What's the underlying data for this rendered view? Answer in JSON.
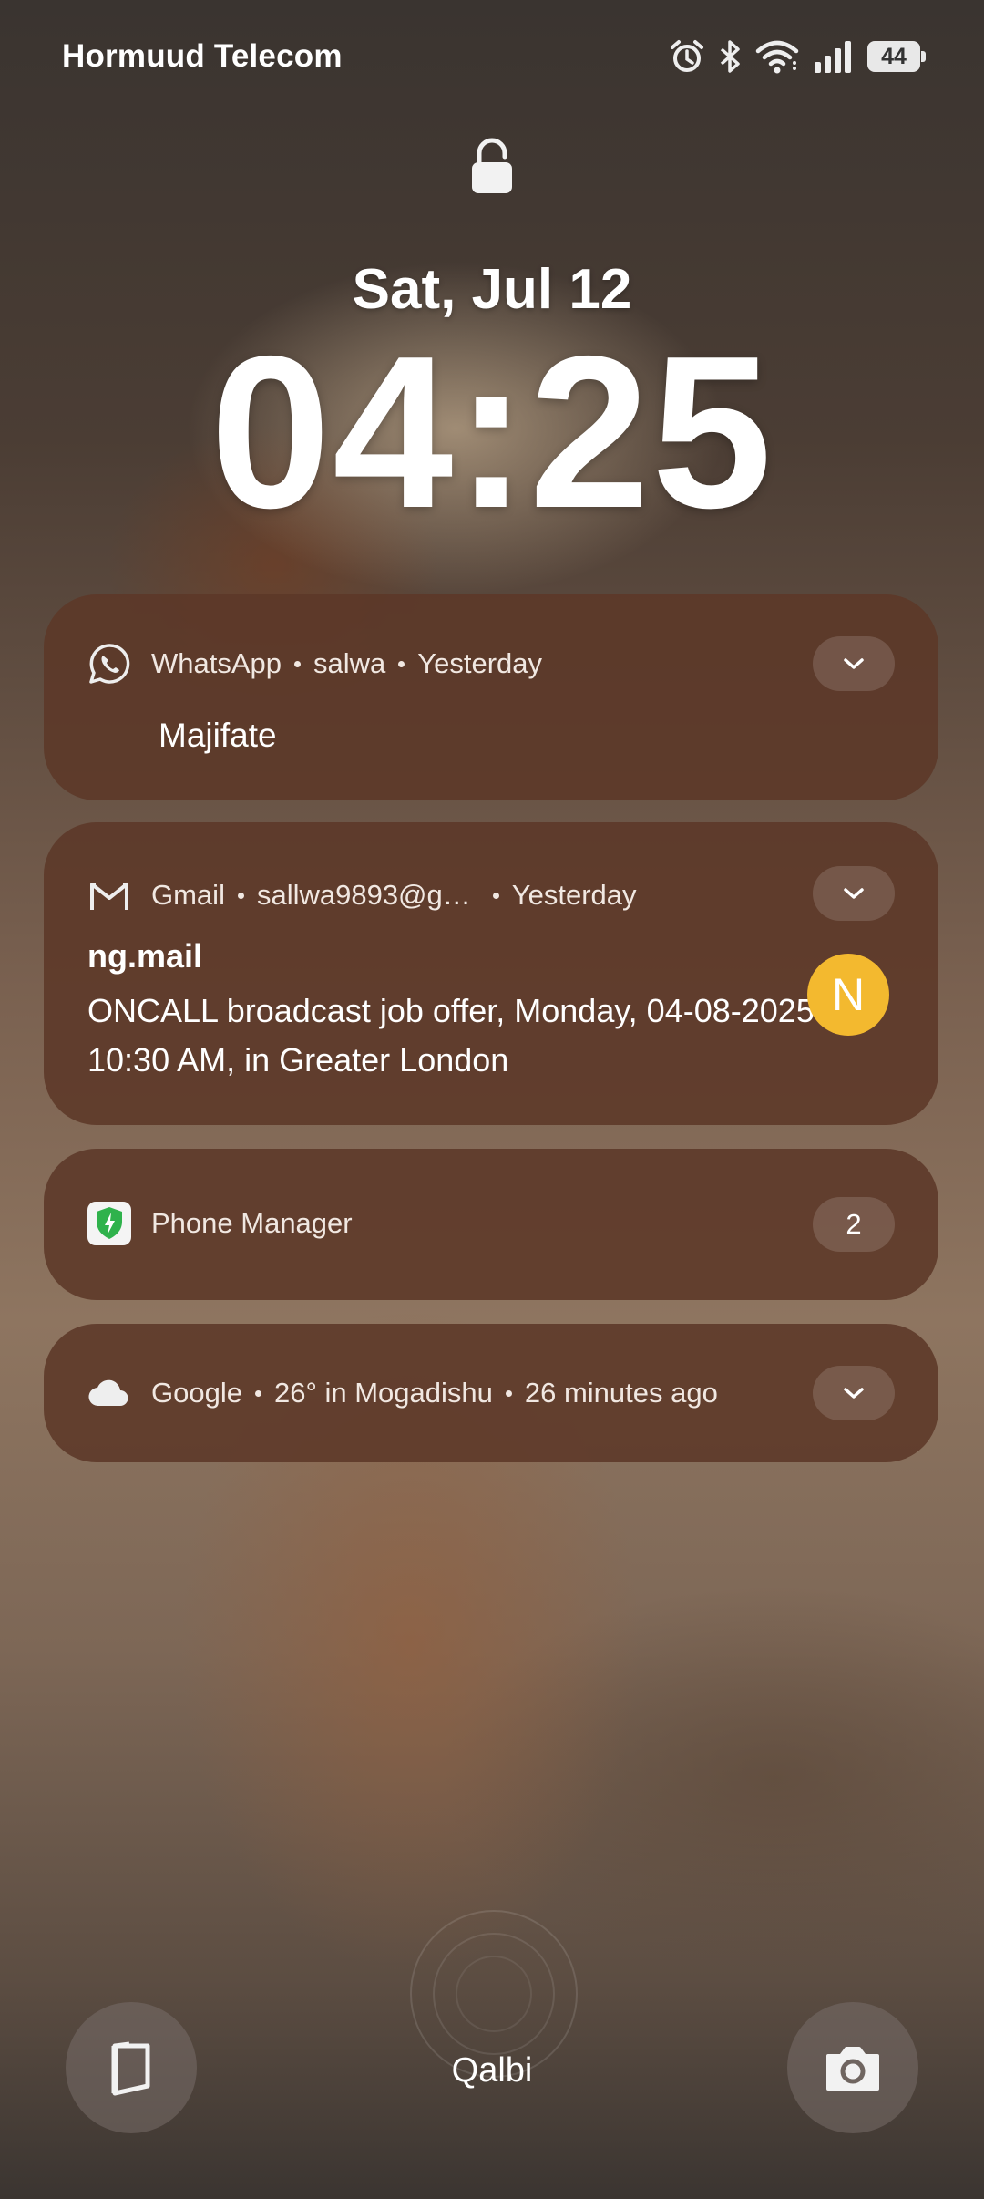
{
  "status_bar": {
    "carrier": "Hormuud Telecom",
    "battery_percent": "44",
    "icons": [
      "alarm-icon",
      "bluetooth-icon",
      "wifi-icon",
      "signal-icon",
      "battery-icon"
    ]
  },
  "lockscreen": {
    "date": "Sat, Jul 12",
    "time": "04:25",
    "owner_text": "Qalbi"
  },
  "notifications": [
    {
      "app": "WhatsApp",
      "sender": "salwa",
      "time": "Yesterday",
      "body": "Majifate",
      "icon": "whatsapp-icon"
    },
    {
      "app": "Gmail",
      "account": "sallwa9893@g…",
      "time": "Yesterday",
      "title": "ng.mail",
      "body": "ONCALL broadcast job offer, Monday, 04-08-2025 10:30 AM, in Greater London",
      "avatar_letter": "N",
      "avatar_color": "#f3b92f",
      "icon": "gmail-icon"
    },
    {
      "app": "Phone Manager",
      "count": "2",
      "icon": "phone-manager-shield-icon"
    },
    {
      "app": "Google",
      "detail": "26° in Mogadishu",
      "time": "26 minutes ago",
      "icon": "cloud-icon"
    }
  ],
  "colors": {
    "card_bg": "#5c3828",
    "avatar": "#f3b92f",
    "shield_green": "#2fb24c"
  }
}
